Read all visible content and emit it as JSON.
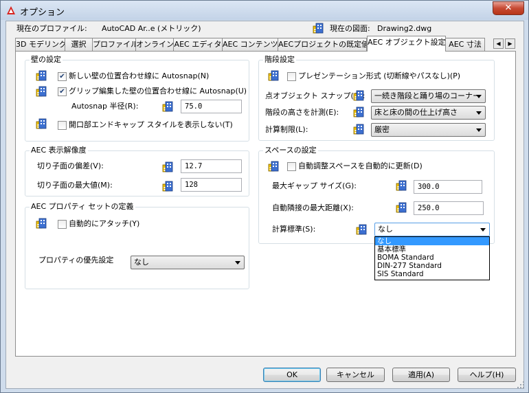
{
  "window": {
    "title": "オプション",
    "close_glyph": "✕"
  },
  "profile": {
    "label": "現在のプロファイル:",
    "value": "AutoCAD Ar..e (メトリック)",
    "drawing_label": "現在の図面:",
    "drawing_value": "Drawing2.dwg"
  },
  "tabs": [
    "3D モデリング",
    "選択",
    "プロファイル",
    "オンライン",
    "AEC エディタ",
    "AEC コンテンツ",
    "AECプロジェクトの既定値",
    "AEC オブジェクト設定",
    "AEC 寸法"
  ],
  "active_tab": "AEC オブジェクト設定",
  "wall": {
    "title": "壁の設定",
    "snap_new": {
      "label": "新しい壁の位置合わせ線に Autosnap(N)",
      "checked": true
    },
    "snap_grip": {
      "label": "グリップ編集した壁の位置合わせ線に Autosnap(U)",
      "checked": true
    },
    "radius_label": "Autosnap 半径(R):",
    "radius_value": "75.0",
    "endcap": {
      "label": "開口部エンドキャップ スタイルを表示しない(T)",
      "checked": false
    }
  },
  "resolution": {
    "title": "AEC 表示解像度",
    "deviation_label": "切り子面の偏差(V):",
    "deviation_value": "12.7",
    "max_label": "切り子面の最大値(M):",
    "max_value": "128"
  },
  "propset": {
    "title": "AEC プロパティ セットの定義",
    "auto_attach": {
      "label": "自動的にアタッチ(Y)",
      "checked": false
    },
    "priority_label": "プロパティの優先設定",
    "priority_value": "なし"
  },
  "stairs": {
    "title": "階段設定",
    "presentation": {
      "label": "プレゼンテーション形式 (切断線やパスなし)(P)",
      "checked": false
    },
    "snap_label": "点オブジェクト スナップ(O):",
    "snap_value": "一続き階段と踊り場のコーナー",
    "height_label": "階段の高さを計測(E):",
    "height_value": "床と床の間の仕上げ高さ",
    "limit_label": "計算制限(L):",
    "limit_value": "厳密"
  },
  "space": {
    "title": "スペースの設定",
    "auto_update": {
      "label": "自動調整スペースを自動的に更新(D)",
      "checked": false
    },
    "gap_label": "最大ギャップ サイズ(G):",
    "gap_value": "300.0",
    "adjacency_label": "自動隣接の最大距離(X):",
    "adjacency_value": "250.0",
    "standard_label": "計算標準(S):",
    "standard_value": "なし",
    "standard_options": [
      "なし",
      "基本標準",
      "BOMA Standard",
      "DIN-277 Standard",
      "SIS Standard"
    ],
    "selected_option": "なし"
  },
  "buttons": {
    "ok": "OK",
    "cancel": "キャンセル",
    "apply": "適用(A)",
    "help": "ヘルプ(H)"
  },
  "colors": {
    "selection": "#3399ff",
    "close": "#c74a34"
  }
}
